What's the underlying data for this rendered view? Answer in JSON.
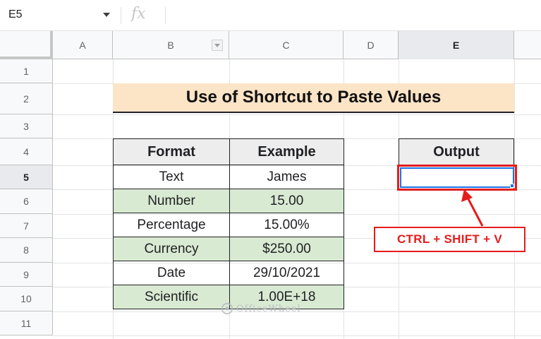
{
  "formula_bar": {
    "name_box": "E5",
    "fx_label": "fx",
    "formula": ""
  },
  "columns": [
    "A",
    "B",
    "C",
    "D",
    "E"
  ],
  "selected_column": "E",
  "rows": [
    "1",
    "2",
    "3",
    "4",
    "5",
    "6",
    "7",
    "8",
    "9",
    "10",
    "11"
  ],
  "selected_row": "5",
  "sheet": {
    "title": "Use of Shortcut to Paste Values",
    "table": {
      "headers": [
        "Format",
        "Example"
      ],
      "rows": [
        [
          "Text",
          "James"
        ],
        [
          "Number",
          "15.00"
        ],
        [
          "Percentage",
          "15.00%"
        ],
        [
          "Currency",
          "$250.00"
        ],
        [
          "Date",
          "29/10/2021"
        ],
        [
          "Scientific",
          "1.00E+18"
        ]
      ]
    },
    "output": {
      "header": "Output",
      "value": ""
    },
    "callout": "CTRL + SHIFT + V"
  },
  "watermark": {
    "text": "OfficeWheel"
  },
  "colors": {
    "title_bg": "#fce4c6",
    "alt_row_bg": "#d9ead3",
    "header_bg": "#ededed",
    "highlight_red": "#e51c1c",
    "selection_blue": "#1a73e8"
  }
}
